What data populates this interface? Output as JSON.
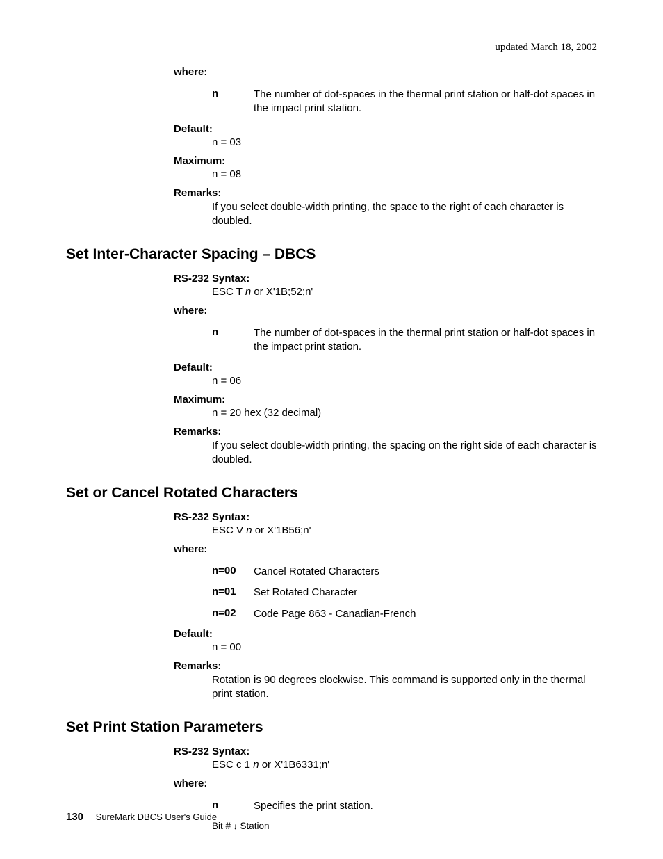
{
  "header": {
    "updated": "updated March 18, 2002"
  },
  "intro": {
    "where_label": "where:",
    "n_term": "n",
    "n_desc": "The number of dot-spaces in the thermal print station or half-dot spaces in the impact print station.",
    "default_label": "Default:",
    "default_value": "n = 03",
    "maximum_label": "Maximum:",
    "maximum_value": "n = 08",
    "remarks_label": "Remarks:",
    "remarks_value": "If you select double-width printing, the space to the right of each character is doubled."
  },
  "section1": {
    "title": "Set Inter-Character Spacing – DBCS",
    "syntax_label": "RS-232 Syntax:",
    "syntax_pre": "ESC T ",
    "syntax_n": "n",
    "syntax_post": " or X'1B;52;n'",
    "where_label": "where:",
    "n_term": "n",
    "n_desc": "The number of dot-spaces in the thermal print station or half-dot spaces in the impact print station.",
    "default_label": "Default:",
    "default_value": "n = 06",
    "maximum_label": "Maximum:",
    "maximum_value": "n = 20 hex (32 decimal)",
    "remarks_label": "Remarks:",
    "remarks_value": "If you select double-width printing, the spacing on the right side of each character is doubled."
  },
  "section2": {
    "title": "Set or Cancel Rotated Characters",
    "syntax_label": "RS-232 Syntax:",
    "syntax_pre": "ESC V ",
    "syntax_n": "n",
    "syntax_post": " or X'1B56;n'",
    "where_label": "where:",
    "options": [
      {
        "term": "n=00",
        "desc": "Cancel Rotated Characters"
      },
      {
        "term": "n=01",
        "desc": "Set Rotated Character"
      },
      {
        "term": "n=02",
        "desc": "Code Page 863 - Canadian-French"
      }
    ],
    "default_label": "Default:",
    "default_value": "n = 00",
    "remarks_label": "Remarks:",
    "remarks_value": "Rotation is 90 degrees clockwise. This command is supported only in the thermal print station."
  },
  "section3": {
    "title": "Set Print Station Parameters",
    "syntax_label": "RS-232 Syntax:",
    "syntax_pre": "ESC c 1 ",
    "syntax_n": "n",
    "syntax_post": " or X'1B6331;n'",
    "where_label": "where:",
    "n_term": "n",
    "n_desc": "Specifies the print station.",
    "table_header_bit": "Bit # ",
    "table_header_station": "  Station"
  },
  "footer": {
    "page_number": "130",
    "guide_title": "SureMark DBCS User's Guide"
  }
}
